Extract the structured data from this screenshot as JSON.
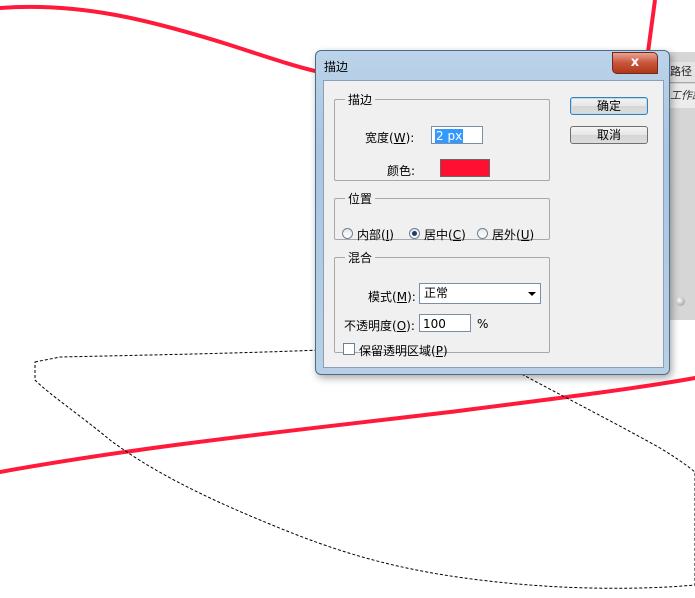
{
  "canvas": {
    "stroke_color": "#ff1a3c",
    "selection_outline": "dashed"
  },
  "side_panel": {
    "tab_label": "路径",
    "row_label": "工作路径"
  },
  "dialog": {
    "title": "描边",
    "close_label": "x",
    "ok_label": "确定",
    "cancel_label": "取消",
    "stroke": {
      "legend": "描边",
      "width_label": "宽度",
      "width_key": "W",
      "width_value": "2 px",
      "color_label": "颜色:",
      "color_value": "#ff0f32"
    },
    "location": {
      "legend": "位置",
      "options": [
        {
          "label": "内部",
          "key": "I",
          "selected": false
        },
        {
          "label": "居中",
          "key": "C",
          "selected": true
        },
        {
          "label": "居外",
          "key": "U",
          "selected": false
        }
      ]
    },
    "blending": {
      "legend": "混合",
      "mode_label": "模式",
      "mode_key": "M",
      "mode_value": "正常",
      "opacity_label": "不透明度",
      "opacity_key": "O",
      "opacity_value": "100",
      "opacity_unit": "%",
      "preserve_label": "保留透明区域",
      "preserve_key": "P",
      "preserve_checked": false
    }
  }
}
